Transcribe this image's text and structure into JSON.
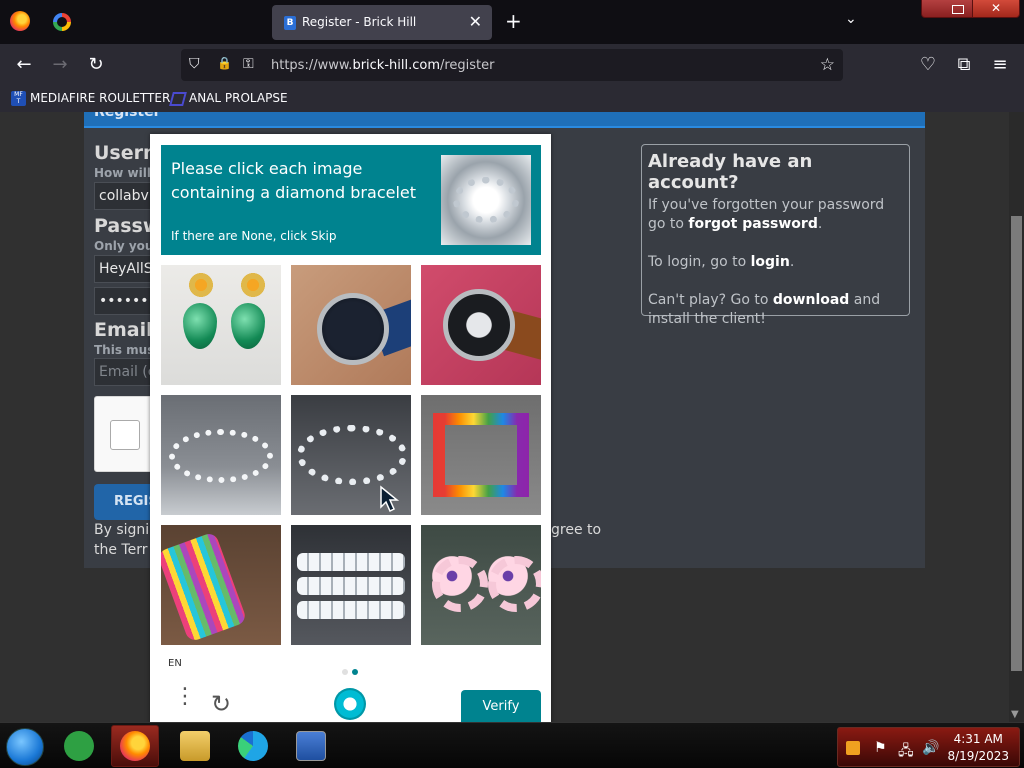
{
  "browser": {
    "tab_title": "Register - Brick Hill",
    "tab_favicon_letter": "B",
    "tab_close": "✕",
    "new_tab": "+",
    "tab_list": "⌄",
    "url_prefix": "https://www.",
    "url_domain": "brick-hill.com",
    "url_path": "/register",
    "back": "←",
    "forward": "→",
    "reload": "↻",
    "shield": "⛉",
    "lock": "🔒",
    "key": "⚿",
    "star": "☆",
    "pocket": "♡",
    "extensions": "⧉",
    "menu": "≡",
    "bookmarks": [
      {
        "icon_text": "MF\nT",
        "label": "MEDIAFIRE ROULETTER"
      },
      {
        "label": "ANAL PROLAPSE"
      }
    ],
    "window_close": "✕"
  },
  "register": {
    "header": "Register",
    "username_label": "Usern",
    "username_sub": "How will",
    "username_value": "collabvr",
    "password_label": "Passw",
    "password_sub": "Only you",
    "password_value": "HeyAllS",
    "password_confirm_value": "••••••••",
    "email_label": "Email",
    "email_sub": "This mus",
    "email_placeholder": "Email (c",
    "register_button": "REGIS",
    "terms_line1": "By signi",
    "terms_line1_right": "gree to",
    "terms_line2": "the Terr"
  },
  "account": {
    "title": "Already have an account?",
    "forgot_pre": "If you've forgotten your password go to ",
    "forgot_link": "forgot password",
    "forgot_post": ".",
    "login_pre": "To login, go to ",
    "login_link": "login",
    "login_post": ".",
    "download_pre": "Can't play? Go to ",
    "download_link": "download",
    "download_post": " and install the client!"
  },
  "captcha": {
    "prompt": "Please click each image containing a diamond bracelet",
    "skip_hint": "If there are None, click Skip",
    "language": "EN",
    "menu_icon": "⋮",
    "refresh_icon": "↻",
    "verify": "Verify",
    "tiles": [
      {
        "name": "green-earrings"
      },
      {
        "name": "blue-strap-watch"
      },
      {
        "name": "brown-strap-watch"
      },
      {
        "name": "silver-tennis-bracelet"
      },
      {
        "name": "diamond-bracelet"
      },
      {
        "name": "braided-rainbow-bracelet"
      },
      {
        "name": "rainbow-thread-bracelet"
      },
      {
        "name": "wide-diamond-bracelet"
      },
      {
        "name": "flower-earrings"
      }
    ],
    "page_dots": [
      false,
      true
    ],
    "dot_active_color": "#00838f",
    "dot_inactive_color": "#e0e0e0",
    "accent": "#00838f"
  },
  "taskbar": {
    "time": "4:31 AM",
    "date": "8/19/2023",
    "tray_flag": "⚑",
    "tray_network": "🖧",
    "tray_volume": "🔊"
  }
}
